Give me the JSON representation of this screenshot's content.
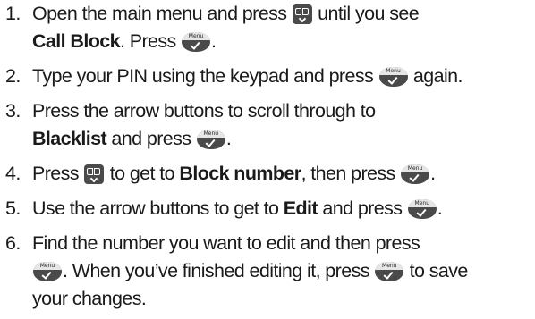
{
  "icons": {
    "nav_button": "phonebook-down-arrow-icon",
    "menu_button": "menu-ok-button-icon",
    "menu_button_text": "Menu"
  },
  "steps": [
    {
      "number": "1.",
      "line1_pre": "Open the main menu and press ",
      "line1_post": " until you see",
      "line2_bold": "Call Block",
      "line2_mid": ". Press ",
      "line2_post": "."
    },
    {
      "number": "2.",
      "pre": "Type your PIN using the keypad and press ",
      "post": " again."
    },
    {
      "number": "3.",
      "line1": "Press the arrow buttons to scroll through to",
      "line2_bold": "Blacklist",
      "line2_mid": " and press ",
      "line2_post": "."
    },
    {
      "number": "4.",
      "pre": "Press ",
      "mid1": " to get to ",
      "bold": "Block number",
      "mid2": ", then press ",
      "post": "."
    },
    {
      "number": "5.",
      "pre": "Use the arrow buttons to get to ",
      "bold": "Edit",
      "mid": " and press ",
      "post": "."
    },
    {
      "number": "6.",
      "line1": "Find the number you want to edit and then press",
      "line2_a": ". When you’ve finished editing it, press ",
      "line2_b": " to save",
      "line3": "your changes."
    }
  ]
}
